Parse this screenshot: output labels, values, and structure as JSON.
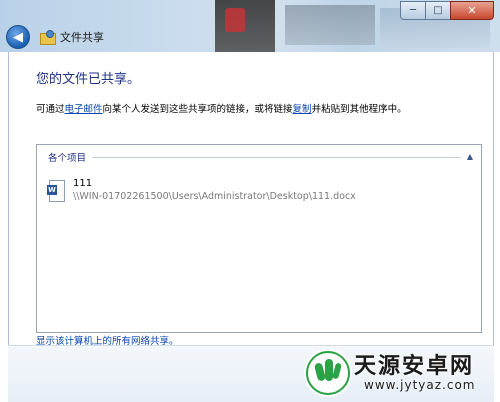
{
  "window": {
    "title": "文件共享",
    "controls": {
      "minimize": "─",
      "maximize": "□",
      "close": "✕"
    },
    "back": "◀"
  },
  "main": {
    "heading": "您的文件已共享。",
    "description": {
      "part1": "可通过",
      "email_link": "电子邮件",
      "part2": "向某个人发送到这些共享项的链接，或将链接",
      "copy_link": "复制",
      "part3": "并粘贴到其他程序中。"
    },
    "items": {
      "group_title": "各个项目",
      "collapse": "▲",
      "files": [
        {
          "name": "111",
          "path": "\\\\WIN-01702261500\\Users\\Administrator\\Desktop\\111.docx",
          "icon": "W"
        }
      ]
    },
    "show_all_link": "显示该计算机上的所有网络共享。"
  },
  "watermark": {
    "title": "天源安卓网",
    "url": "www.jytyaz.com"
  }
}
